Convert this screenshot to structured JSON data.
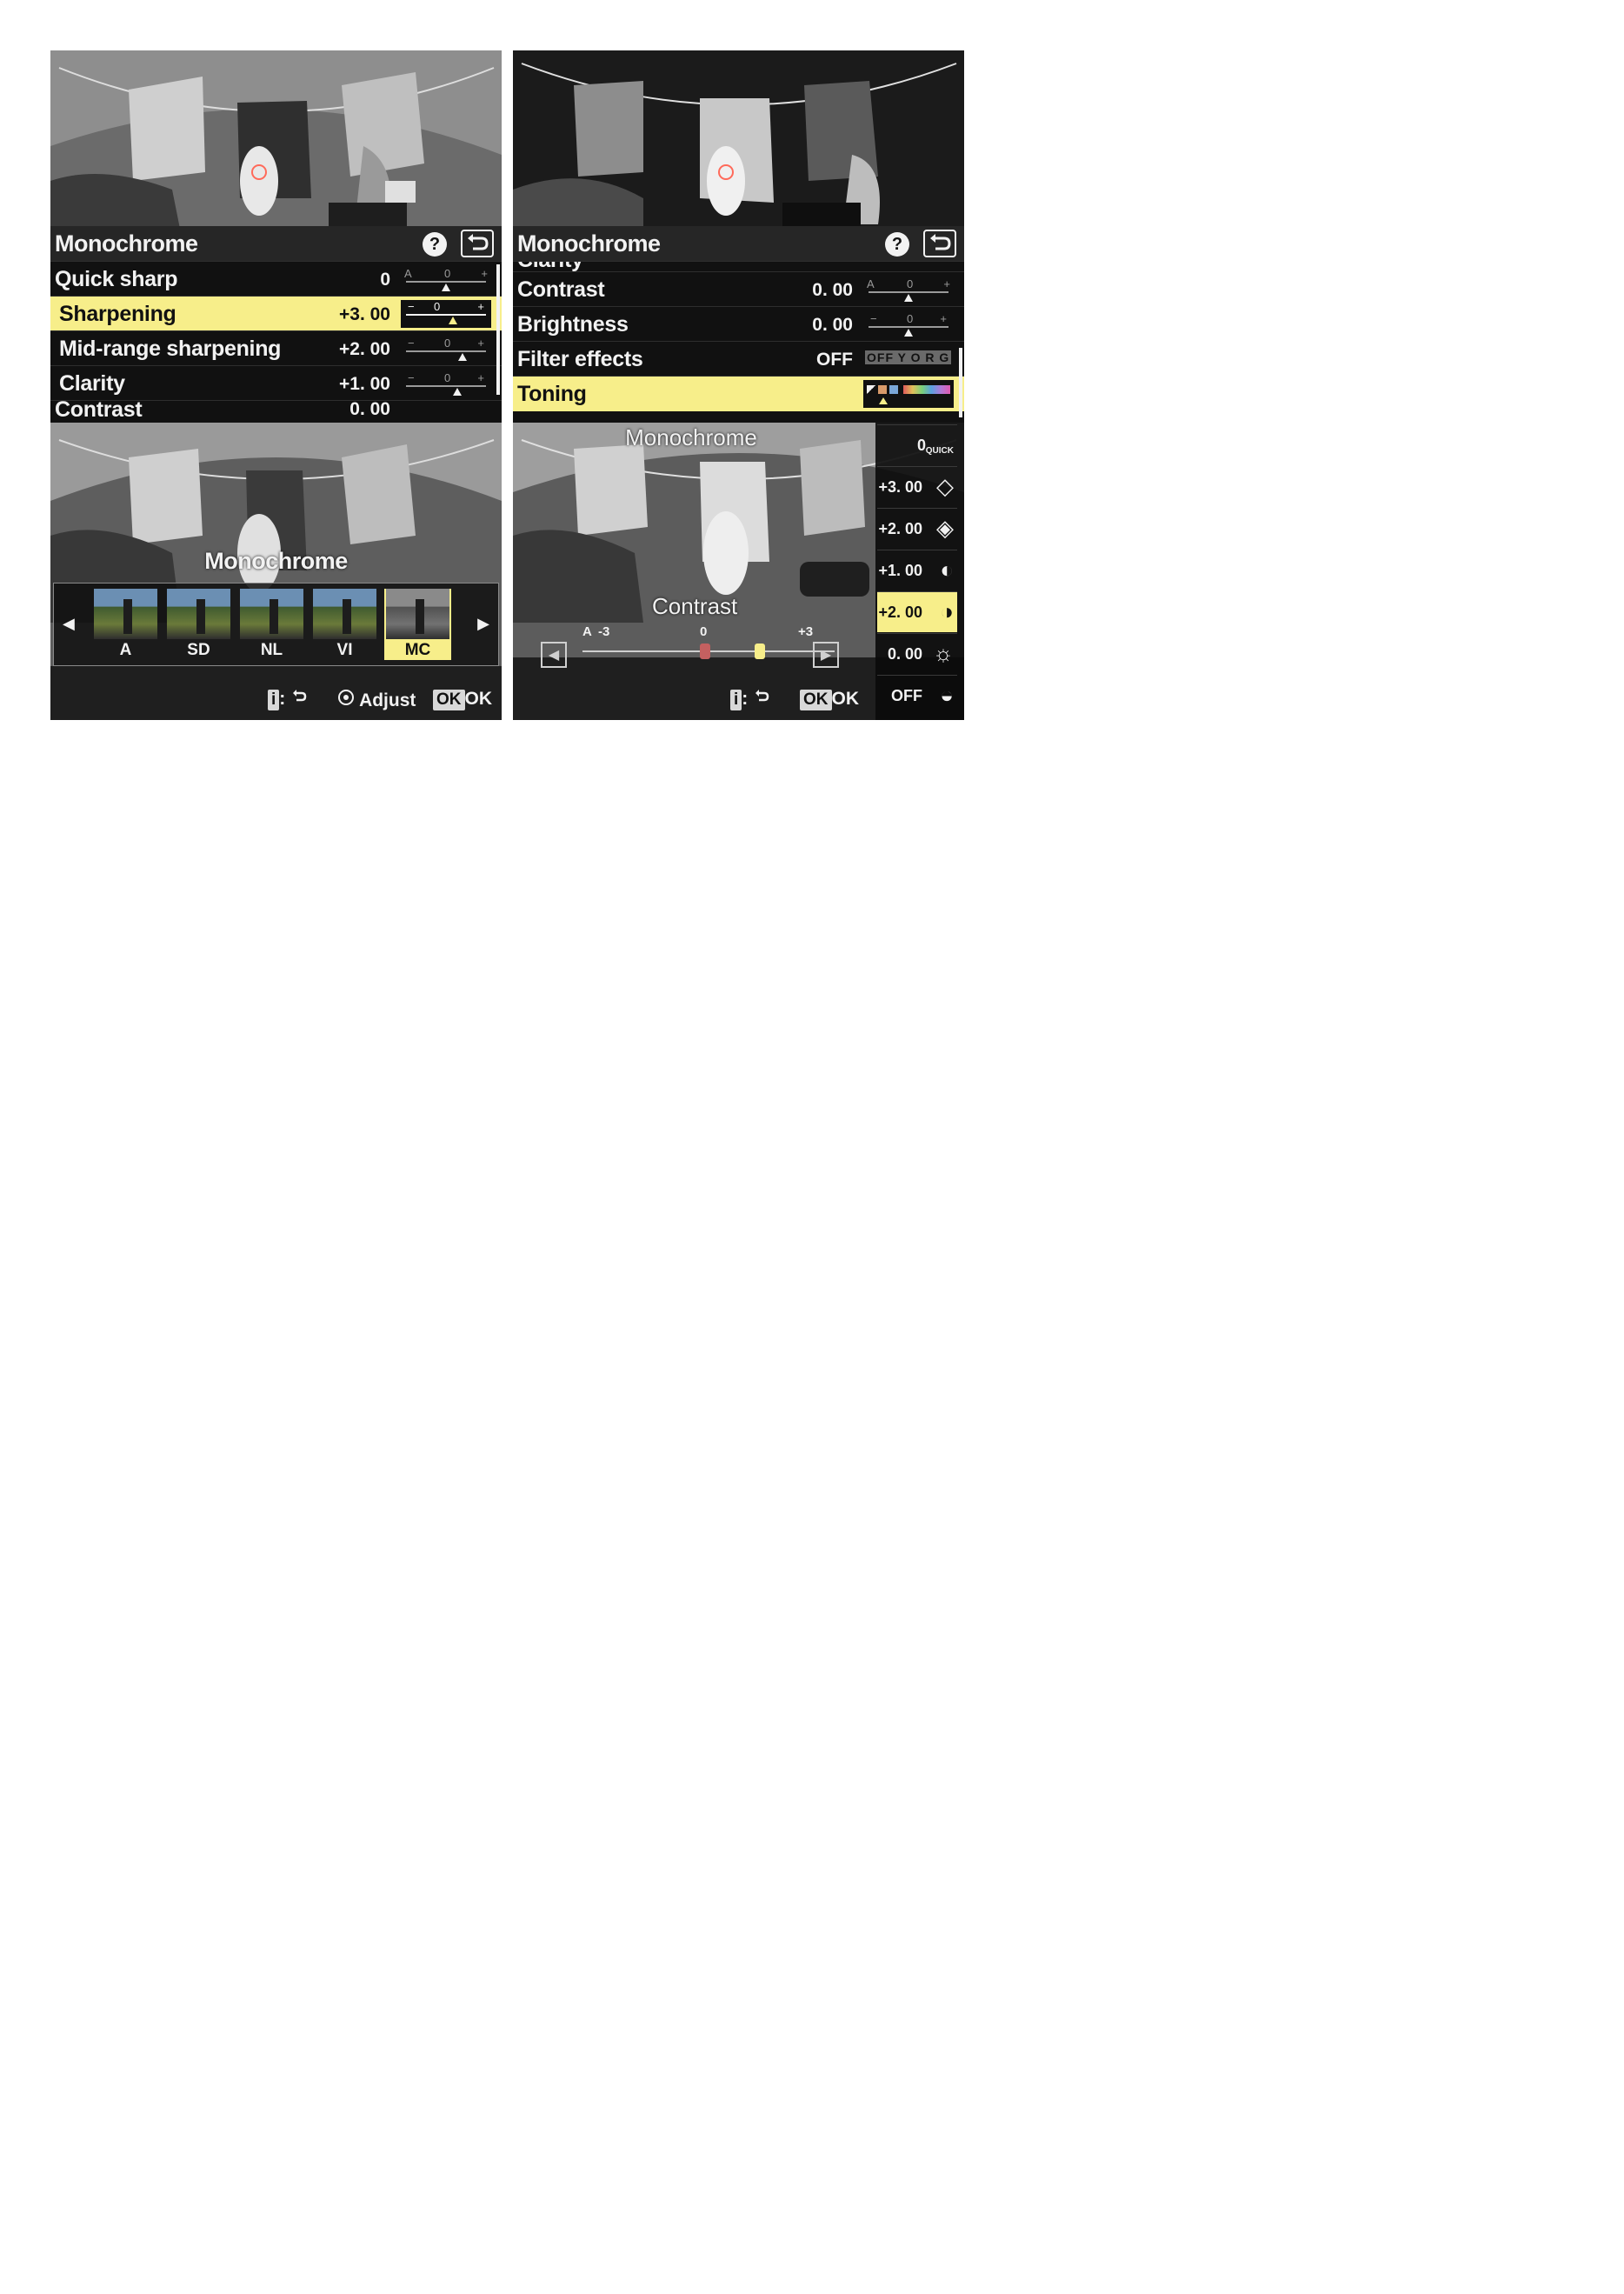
{
  "colors": {
    "highlight": "#f7ee8a",
    "menu_background": "#111111",
    "text": "#f2f2f2"
  },
  "panel1": {
    "title": "Monochrome",
    "help_icon": "?",
    "back_icon": "back-arrow-icon",
    "rows": [
      {
        "label": "Quick sharp",
        "value": "0",
        "selected": false,
        "slider": "A 0"
      },
      {
        "label": "Sharpening",
        "value": "+3. 00",
        "selected": true,
        "slider": "0"
      },
      {
        "label": "Mid-range sharpening",
        "value": "+2. 00",
        "selected": false,
        "slider": "0"
      },
      {
        "label": "Clarity",
        "value": "+1. 00",
        "selected": false,
        "slider": "0"
      },
      {
        "label": "Contrast",
        "value": "0. 00",
        "selected": false,
        "slider": "A 0"
      }
    ]
  },
  "panel2": {
    "title": "Monochrome",
    "help_icon": "?",
    "back_icon": "back-arrow-icon",
    "partial_top_label": "Clarity",
    "rows": [
      {
        "label": "Contrast",
        "value": "0. 00",
        "selected": false
      },
      {
        "label": "Brightness",
        "value": "0. 00",
        "selected": false
      },
      {
        "label": "Filter effects",
        "value": "OFF",
        "selected": false,
        "options": "OFF Y O R G"
      },
      {
        "label": "Toning",
        "value": "",
        "selected": true
      }
    ]
  },
  "panel3": {
    "title": "Monochrome",
    "items": [
      "A",
      "SD",
      "NL",
      "VI",
      "MC"
    ],
    "selected": "MC",
    "hints": {
      "back": ":",
      "adjust": "Adjust",
      "ok": "OK",
      "ok_key": "OK"
    }
  },
  "panel4": {
    "title": "Monochrome",
    "parameter": "Contrast",
    "scale": {
      "auto": "A",
      "min": "-3",
      "mid": "0",
      "max": "+3"
    },
    "side_items": [
      {
        "value": "0",
        "tag": "QUICK",
        "icon": "quick-sharp-icon"
      },
      {
        "value": "+3. 00",
        "icon": "sharpening-icon"
      },
      {
        "value": "+2. 00",
        "icon": "mid-range-sharpening-icon"
      },
      {
        "value": "+1. 00",
        "icon": "clarity-icon"
      },
      {
        "value": "+2. 00",
        "icon": "contrast-icon",
        "selected": true
      },
      {
        "value": "0. 00",
        "icon": "brightness-icon"
      },
      {
        "value": "OFF",
        "icon": "filter-effects-icon"
      }
    ],
    "hints": {
      "back": ":",
      "ok": "OK",
      "ok_key": "OK"
    }
  }
}
